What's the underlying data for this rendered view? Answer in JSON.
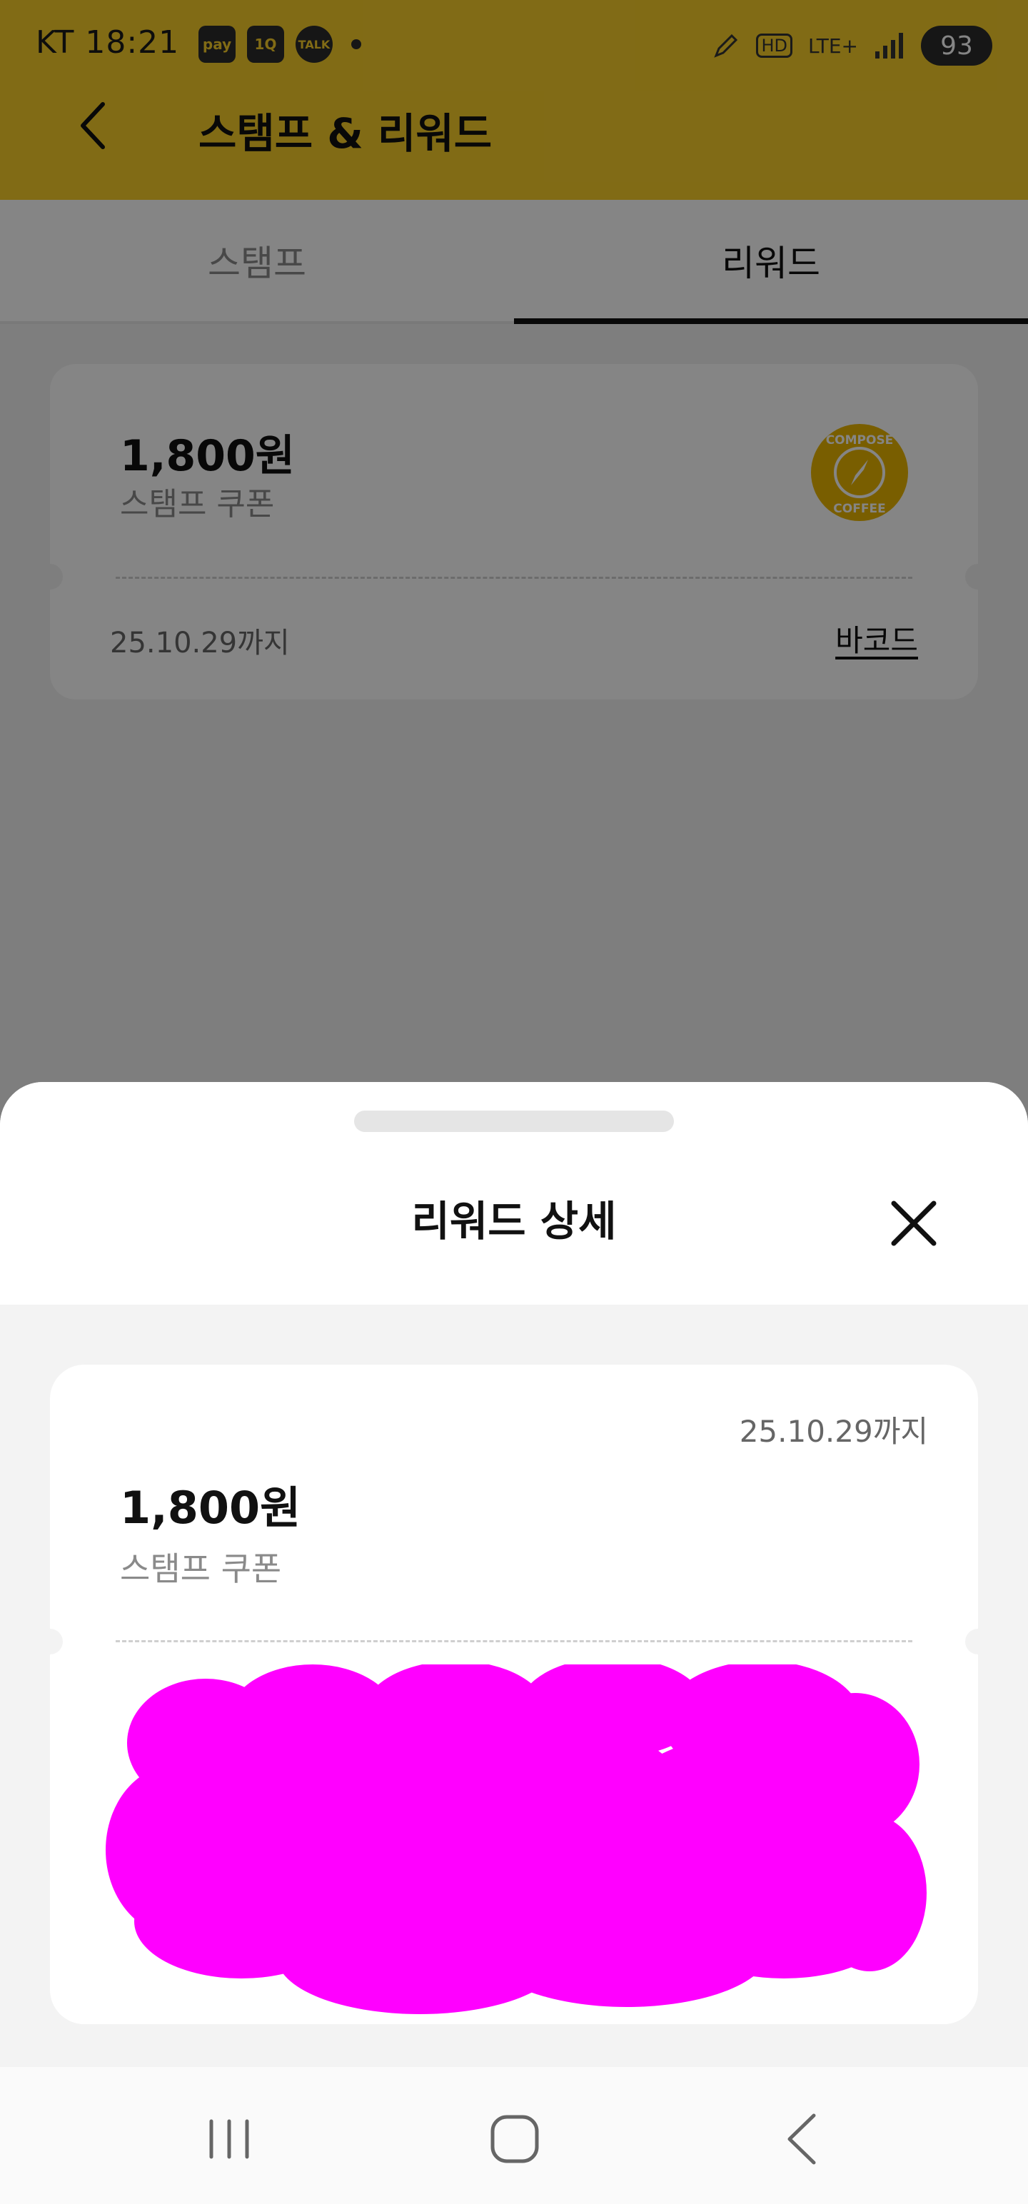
{
  "status_bar": {
    "carrier": "KT",
    "time": "18:21",
    "left_badges": [
      "pay",
      "1Q",
      "TALK"
    ],
    "network": "LTE+",
    "hd_label": "HD",
    "battery": "93",
    "icons": [
      "pay-app-icon",
      "onestore-icon",
      "kakaotalk-icon",
      "dot-indicator-icon",
      "pen-icon",
      "hd-icon",
      "lte-icon",
      "signal-icon",
      "battery-icon"
    ]
  },
  "header": {
    "title": "스탬프 & 리워드",
    "back_icon": "chevron-left-icon"
  },
  "tabs": [
    {
      "label": "스탬프",
      "active": false
    },
    {
      "label": "리워드",
      "active": true
    }
  ],
  "coupon": {
    "amount": "1,800원",
    "type": "스탬프 쿠폰",
    "expiry": "25.10.29까지",
    "barcode_link": "바코드",
    "logo_text_top": "COMPOSE",
    "logo_text_bottom": "COFFEE",
    "logo_color": "#e8b400"
  },
  "sheet": {
    "title": "리워드 상세",
    "close_icon": "close-icon",
    "detail": {
      "expiry": "25.10.29까지",
      "amount": "1,800원",
      "type": "스탬프 쿠폰",
      "barcode_redacted": true,
      "redaction_color": "#ff00ff"
    }
  },
  "nav_bar": {
    "icons": [
      "recent-apps-icon",
      "home-icon",
      "back-icon"
    ]
  },
  "colors": {
    "header_yellow": "#f7cd2a",
    "overlay": "rgba(0,0,0,0.48)",
    "text_primary": "#111111",
    "text_secondary": "#8a8a8a"
  }
}
